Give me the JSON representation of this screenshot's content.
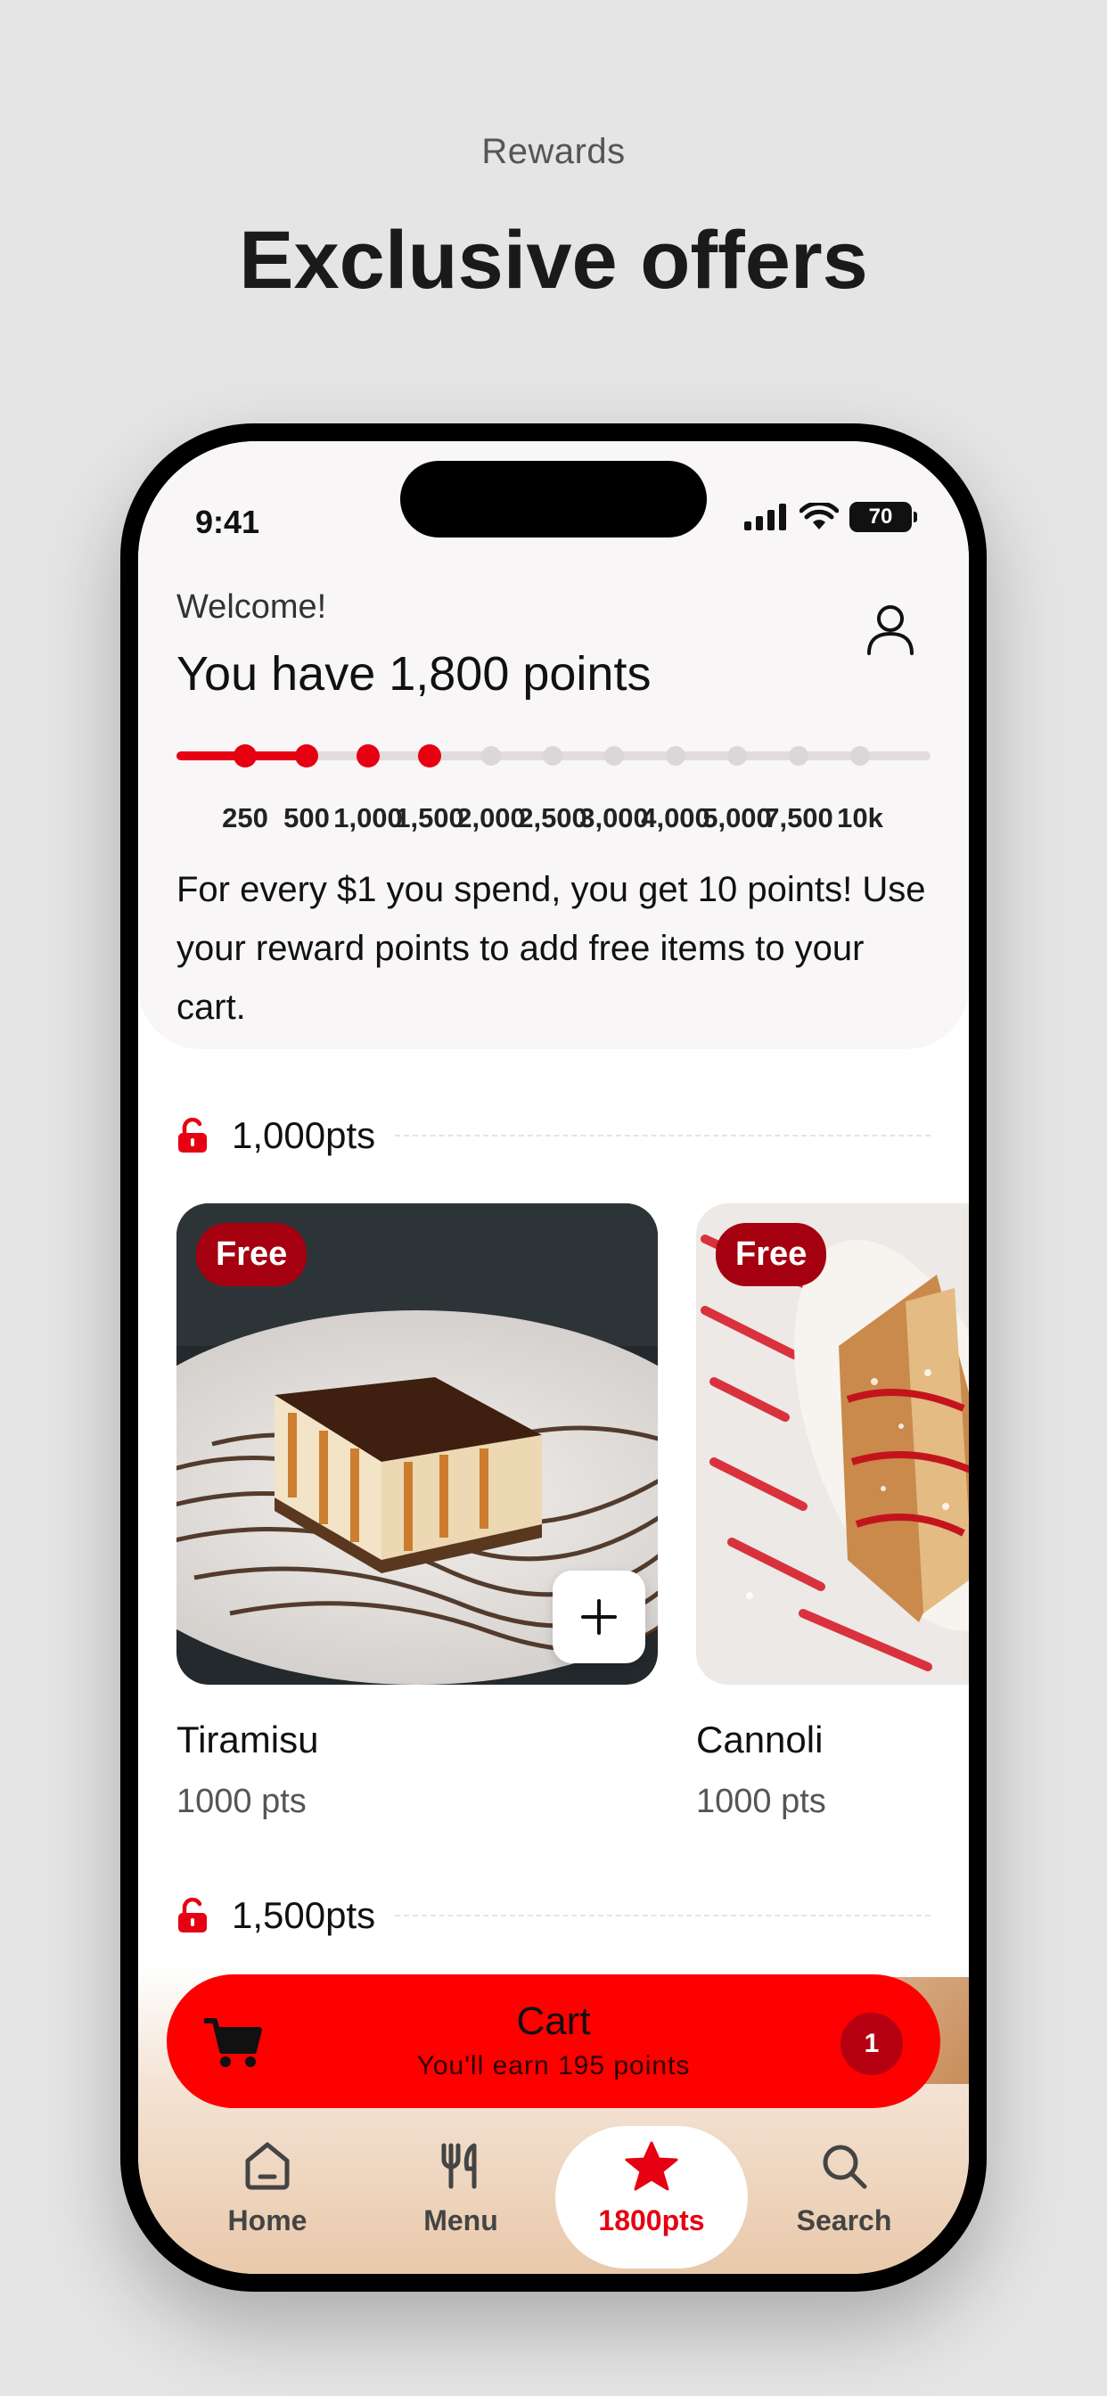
{
  "promo": {
    "subtitle": "Rewards",
    "title": "Exclusive offers"
  },
  "status_bar": {
    "time": "9:41",
    "battery": "70"
  },
  "header": {
    "welcome": "Welcome!",
    "points_title": "You have 1,800 points",
    "progress": {
      "current_points": 1800,
      "ticks": [
        "250",
        "500",
        "1,000",
        "1,500",
        "2,000",
        "2,500",
        "3,000",
        "4,000",
        "5,000",
        "7,500",
        "10k"
      ],
      "reached_count": 4
    },
    "info": "For every $1 you spend, you get 10 points! Use your reward points to add free items to your cart."
  },
  "sections": [
    {
      "label": "1,000pts",
      "items": [
        {
          "badge": "Free",
          "name": "Tiramisu",
          "points": "1000 pts"
        },
        {
          "badge": "Free",
          "name": "Cannoli",
          "points": "1000 pts"
        }
      ]
    },
    {
      "label": "1,500pts"
    }
  ],
  "cart": {
    "title": "Cart",
    "subtitle": "You'll earn 195 points",
    "count": "1"
  },
  "nav": {
    "items": [
      {
        "label": "Home",
        "icon": "home-icon"
      },
      {
        "label": "Menu",
        "icon": "fork-knife-icon"
      },
      {
        "label": "1800pts",
        "icon": "star-icon",
        "active": true
      },
      {
        "label": "Search",
        "icon": "search-icon"
      }
    ]
  },
  "colors": {
    "accent": "#e60012",
    "cart_bg": "#ff0000",
    "badge_bg": "#a50010"
  }
}
